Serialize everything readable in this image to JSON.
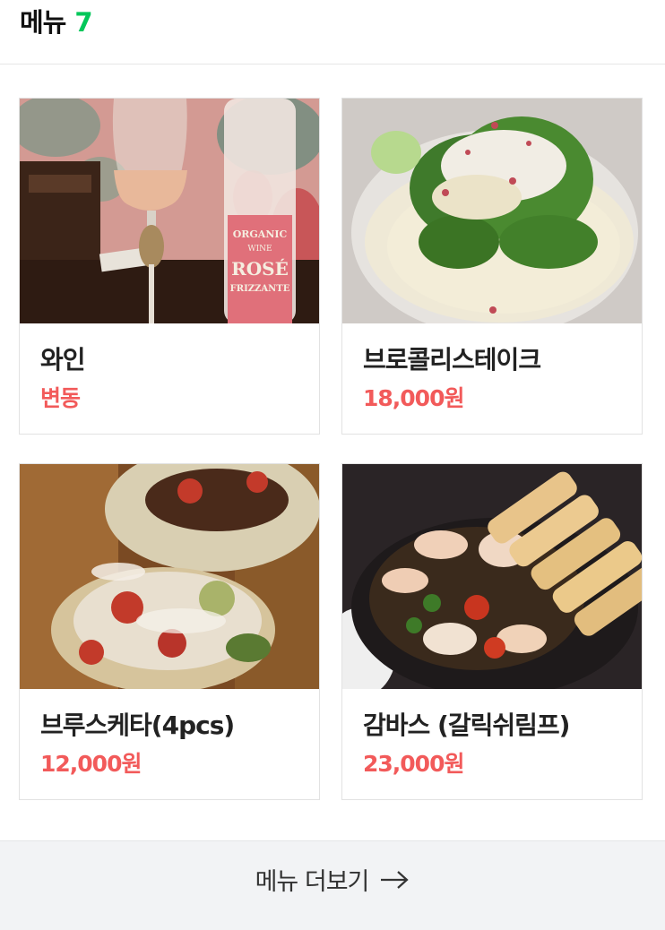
{
  "header": {
    "title": "메뉴",
    "count": "7"
  },
  "menu_items": [
    {
      "name": "와인",
      "price": "변동"
    },
    {
      "name": "브로콜리스테이크",
      "price": "18,000원"
    },
    {
      "name": "브루스케타(4pcs)",
      "price": "12,000원"
    },
    {
      "name": "감바스 (갈릭쉬림프)",
      "price": "23,000원"
    }
  ],
  "wine_label": {
    "line1": "ORGANIC",
    "line2": "WINE",
    "line3": "ROSÉ",
    "line4": "FRIZZANTE"
  },
  "footer": {
    "more_label": "메뉴 더보기"
  },
  "colors": {
    "accent_green": "#03c75a",
    "price_red": "#f25a5a"
  }
}
